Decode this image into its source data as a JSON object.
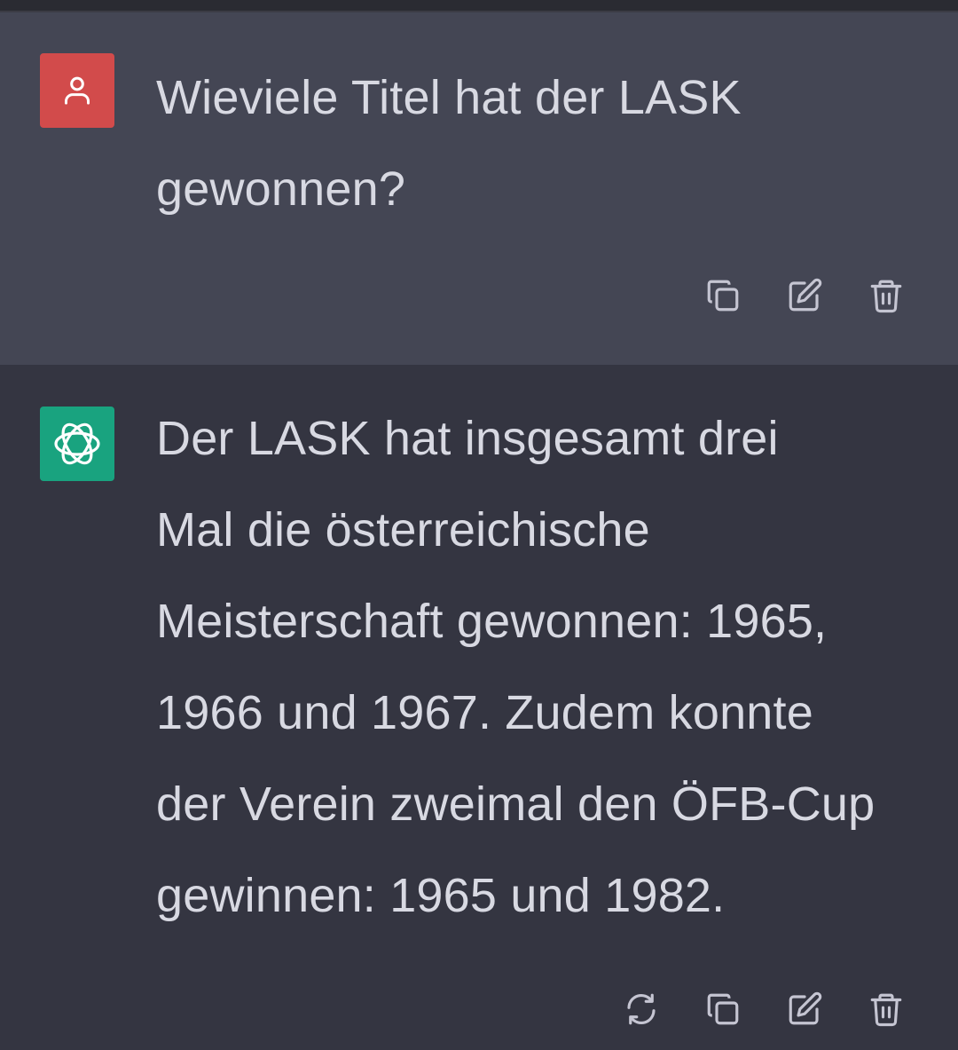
{
  "conversation": {
    "user_message": {
      "role": "user",
      "avatar_icon": "user-icon",
      "avatar_color": "#d24b4b",
      "text": "Wieviele Titel hat der LASK\ngewonnen?",
      "actions": [
        "copy-icon",
        "edit-icon",
        "trash-icon"
      ]
    },
    "assistant_message": {
      "role": "assistant",
      "avatar_icon": "openai-logo-icon",
      "avatar_color": "#19a37f",
      "text": "Der LASK hat insgesamt drei\nMal die österreichische\nMeisterschaft gewonnen: 1965,\n1966 und 1967. Zudem konnte\nder Verein zweimal den ÖFB-Cup\ngewinnen: 1965 und 1982.",
      "actions": [
        "regenerate-icon",
        "copy-icon",
        "edit-icon",
        "trash-icon"
      ]
    }
  },
  "colors": {
    "user_bg": "#444654",
    "assistant_bg": "#343541",
    "text": "#d8d9e2",
    "icon": "#c5c5d2"
  }
}
